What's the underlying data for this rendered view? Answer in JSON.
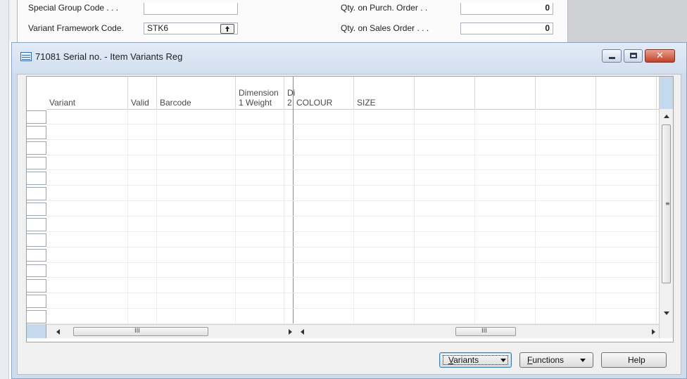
{
  "background_form": {
    "special_group_code_label": "Special Group Code . . .",
    "special_group_code_value": "",
    "variant_framework_code_label": "Variant Framework Code.",
    "variant_framework_code_value": "STK6",
    "qty_on_purch_order_label": "Qty. on Purch. Order . .",
    "qty_on_purch_order_value": "0",
    "qty_on_sales_order_label": "Qty. on Sales Order . . .",
    "qty_on_sales_order_value": "0"
  },
  "window": {
    "title": "71081 Serial no. - Item Variants Reg",
    "close_glyph": "✕"
  },
  "grid": {
    "columns": [
      {
        "line1": "",
        "line2": "Variant"
      },
      {
        "line1": "",
        "line2": "Valid"
      },
      {
        "line1": "",
        "line2": "Barcode"
      },
      {
        "line1": "Dimension",
        "line2": "1 Weight"
      },
      {
        "line1": "Di",
        "line2": "2"
      },
      {
        "line1": "",
        "line2": "COLOUR"
      },
      {
        "line1": "",
        "line2": "SIZE"
      },
      {
        "line1": "",
        "line2": ""
      },
      {
        "line1": "",
        "line2": ""
      },
      {
        "line1": "",
        "line2": ""
      },
      {
        "line1": "",
        "line2": ""
      }
    ],
    "scroll_grip": "III",
    "vscroll_grip": "≡"
  },
  "buttons": {
    "variants": {
      "mnemonic": "V",
      "rest": "ariants"
    },
    "functions": {
      "mnemonic": "F",
      "rest": "unctions"
    },
    "help": "Help"
  },
  "colors": {
    "title_bar": "#d3dff0",
    "close_button": "#c2412a",
    "selection_cell": "#c4d8ee"
  },
  "icons": [
    "table-icon",
    "minimize-icon",
    "maximize-icon",
    "close-icon",
    "lookup-arrow-icon",
    "dropdown-caret-icon",
    "scroll-arrow-icon"
  ]
}
